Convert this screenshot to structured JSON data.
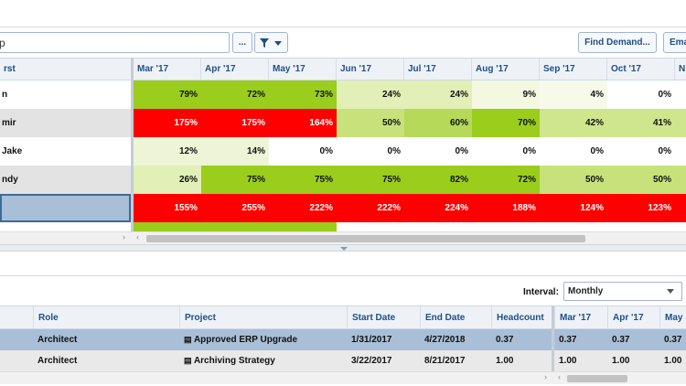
{
  "search": {
    "value": "p"
  },
  "toolbar": {
    "ellipsis_label": "...",
    "find_demand_label": "Find Demand...",
    "email_label": "Ema"
  },
  "upper_grid": {
    "name_header": "rst",
    "months": [
      "Mar '17",
      "Apr '17",
      "May '17",
      "Jun '17",
      "Jul '17",
      "Aug '17",
      "Sep '17",
      "Oct '17",
      "N"
    ],
    "rows": [
      {
        "name": "n",
        "values": [
          "79%",
          "72%",
          "73%",
          "24%",
          "24%",
          "9%",
          "4%",
          "0%"
        ],
        "colors": [
          "#9acd1c",
          "#9acd1c",
          "#9acd1c",
          "#e2efb6",
          "#e2efb6",
          "#f4f8e1",
          "#f7faeb",
          "#ffffff"
        ]
      },
      {
        "name": "mir",
        "values": [
          "175%",
          "175%",
          "164%",
          "50%",
          "60%",
          "70%",
          "42%",
          "41%"
        ],
        "colors": [
          "#ff0000",
          "#ff0000",
          "#ff0000",
          "#c7e27b",
          "#b6d95a",
          "#9acd1c",
          "#cfe68c",
          "#cfe68c"
        ]
      },
      {
        "name": "Jake",
        "values": [
          "12%",
          "14%",
          "0%",
          "0%",
          "0%",
          "0%",
          "0%",
          "0%"
        ],
        "colors": [
          "#eef5d6",
          "#eef5d6",
          "#ffffff",
          "#ffffff",
          "#ffffff",
          "#ffffff",
          "#ffffff",
          "#ffffff"
        ]
      },
      {
        "name": "ndy",
        "values": [
          "26%",
          "75%",
          "75%",
          "75%",
          "82%",
          "72%",
          "50%",
          "50%"
        ],
        "colors": [
          "#e2efb6",
          "#9acd1c",
          "#9acd1c",
          "#9acd1c",
          "#9acd1c",
          "#9acd1c",
          "#c7e27b",
          "#c7e27b"
        ]
      },
      {
        "name": "",
        "values": [
          "155%",
          "255%",
          "222%",
          "222%",
          "224%",
          "188%",
          "124%",
          "123%"
        ],
        "colors": [
          "#ff0000",
          "#ff0000",
          "#ff0000",
          "#ff0000",
          "#ff0000",
          "#ff0000",
          "#ff0000",
          "#ff0000"
        ]
      }
    ]
  },
  "interval": {
    "label": "Interval:",
    "value": "Monthly"
  },
  "lower_grid": {
    "headers": [
      "Role",
      "Project",
      "Start Date",
      "End Date",
      "Headcount",
      "Mar '17",
      "Apr '17",
      "May"
    ],
    "rows": [
      {
        "role": "Architect",
        "project": "Approved ERP Upgrade",
        "start": "1/31/2017",
        "end": "4/27/2018",
        "headcount": "0.37",
        "m1": "0.37",
        "m2": "0.37",
        "m3": "0.37"
      },
      {
        "role": "Architect",
        "project": "Archiving Strategy",
        "start": "3/22/2017",
        "end": "8/21/2017",
        "headcount": "1.00",
        "m1": "1.00",
        "m2": "1.00",
        "m3": "1.00"
      }
    ]
  }
}
